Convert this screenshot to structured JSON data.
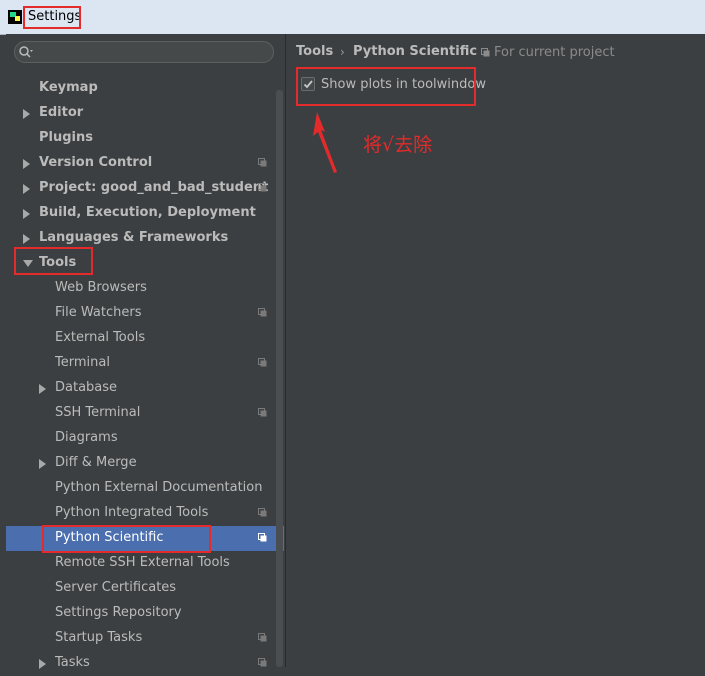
{
  "window": {
    "title": "Settings"
  },
  "search": {
    "placeholder": ""
  },
  "sidebar": {
    "items": [
      {
        "label": "Keymap",
        "bold": true,
        "arrow": "none",
        "project": false
      },
      {
        "label": "Editor",
        "bold": true,
        "arrow": "right",
        "project": false
      },
      {
        "label": "Plugins",
        "bold": true,
        "arrow": "none",
        "project": false
      },
      {
        "label": "Version Control",
        "bold": true,
        "arrow": "right",
        "project": true
      },
      {
        "label": "Project: good_and_bad_student",
        "bold": true,
        "arrow": "right",
        "project": true
      },
      {
        "label": "Build, Execution, Deployment",
        "bold": true,
        "arrow": "right",
        "project": false
      },
      {
        "label": "Languages & Frameworks",
        "bold": true,
        "arrow": "right",
        "project": false
      },
      {
        "label": "Tools",
        "bold": true,
        "arrow": "down",
        "project": false
      },
      {
        "label": "Web Browsers",
        "bold": false,
        "arrow": "none",
        "project": false
      },
      {
        "label": "File Watchers",
        "bold": false,
        "arrow": "none",
        "project": true
      },
      {
        "label": "External Tools",
        "bold": false,
        "arrow": "none",
        "project": false
      },
      {
        "label": "Terminal",
        "bold": false,
        "arrow": "none",
        "project": true
      },
      {
        "label": "Database",
        "bold": false,
        "arrow": "right",
        "project": false
      },
      {
        "label": "SSH Terminal",
        "bold": false,
        "arrow": "none",
        "project": true
      },
      {
        "label": "Diagrams",
        "bold": false,
        "arrow": "none",
        "project": false
      },
      {
        "label": "Diff & Merge",
        "bold": false,
        "arrow": "right",
        "project": false
      },
      {
        "label": "Python External Documentation",
        "bold": false,
        "arrow": "none",
        "project": false
      },
      {
        "label": "Python Integrated Tools",
        "bold": false,
        "arrow": "none",
        "project": true
      },
      {
        "label": "Python Scientific",
        "bold": false,
        "arrow": "none",
        "project": true,
        "selected": true
      },
      {
        "label": "Remote SSH External Tools",
        "bold": false,
        "arrow": "none",
        "project": false
      },
      {
        "label": "Server Certificates",
        "bold": false,
        "arrow": "none",
        "project": false
      },
      {
        "label": "Settings Repository",
        "bold": false,
        "arrow": "none",
        "project": false
      },
      {
        "label": "Startup Tasks",
        "bold": false,
        "arrow": "none",
        "project": true
      },
      {
        "label": "Tasks",
        "bold": false,
        "arrow": "right",
        "project": true
      }
    ]
  },
  "breadcrumb": {
    "root": "Tools",
    "separator": "›",
    "current": "Python Scientific",
    "scope": "For current project"
  },
  "settings": {
    "show_plots_label": "Show plots in toolwindow",
    "show_plots_checked": true
  },
  "annotation": {
    "text": "将√去除"
  },
  "colors": {
    "highlight_red": "#e32b2b",
    "selection": "#4b6eaf",
    "background": "#3c3f41"
  }
}
